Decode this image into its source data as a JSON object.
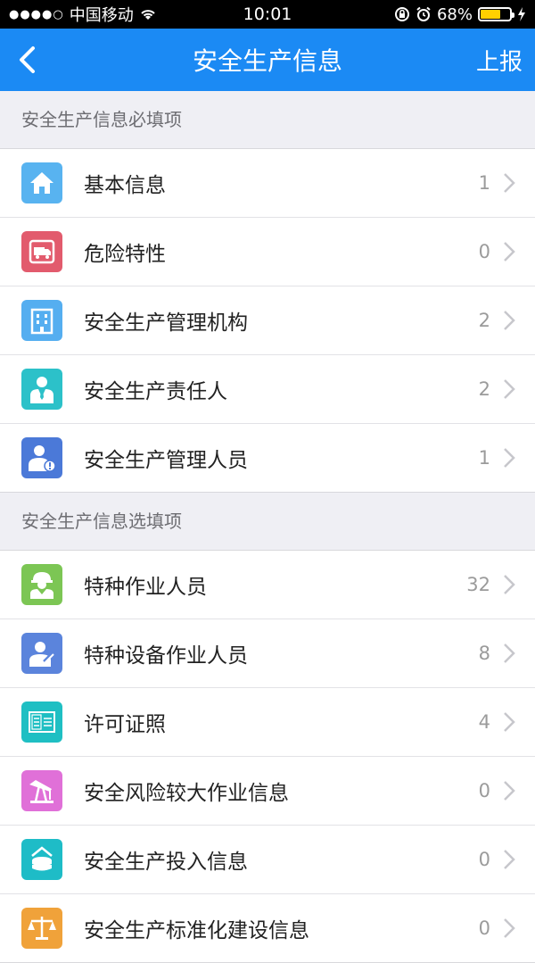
{
  "status_bar": {
    "signal_dots": "●●●●○",
    "carrier": "中国移动",
    "time": "10:01",
    "battery_percent": "68%"
  },
  "nav": {
    "title": "安全生产信息",
    "action": "上报",
    "back_icon": "chevron-left-icon"
  },
  "sections": [
    {
      "header": "安全生产信息必填项",
      "items": [
        {
          "label": "基本信息",
          "count": "1",
          "icon": "home-icon",
          "color": "#58b3f0"
        },
        {
          "label": "危险特性",
          "count": "0",
          "icon": "hazard-truck-icon",
          "color": "#e25b6d"
        },
        {
          "label": "安全生产管理机构",
          "count": "2",
          "icon": "building-icon",
          "color": "#55aef0"
        },
        {
          "label": "安全生产责任人",
          "count": "2",
          "icon": "person-suit-icon",
          "color": "#2cc1c9"
        },
        {
          "label": "安全生产管理人员",
          "count": "1",
          "icon": "manager-alert-icon",
          "color": "#4b79d8"
        }
      ]
    },
    {
      "header": "安全生产信息选填项",
      "items": [
        {
          "label": "特种作业人员",
          "count": "32",
          "icon": "worker-helmet-icon",
          "color": "#7cc654"
        },
        {
          "label": "特种设备作业人员",
          "count": "8",
          "icon": "equipment-operator-icon",
          "color": "#5b84dc"
        },
        {
          "label": "许可证照",
          "count": "4",
          "icon": "license-icon",
          "color": "#1fbfc3"
        },
        {
          "label": "安全风险较大作业信息",
          "count": "0",
          "icon": "oil-pump-icon",
          "color": "#e070d8"
        },
        {
          "label": "安全生产投入信息",
          "count": "0",
          "icon": "investment-icon",
          "color": "#1ebcc7"
        },
        {
          "label": "安全生产标准化建设信息",
          "count": "0",
          "icon": "scale-icon",
          "color": "#f0a23a"
        }
      ]
    }
  ]
}
